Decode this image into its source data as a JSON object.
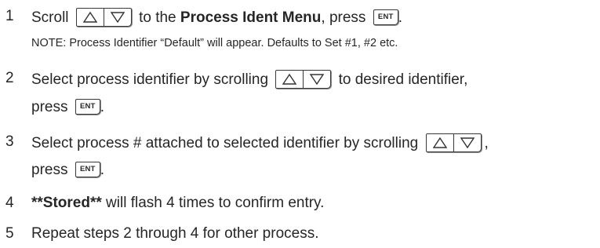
{
  "keys": {
    "enter": "ENT"
  },
  "icons": {
    "up": "up-triangle-icon",
    "down": "down-triangle-icon"
  },
  "steps": [
    {
      "number": "1",
      "pre": "Scroll",
      "mid": "to the",
      "bold": "Process Ident Menu",
      "post": ", press",
      "end": ".",
      "note": "NOTE:  Process Identifier “Default” will appear. Defaults to Set #1, #2 etc."
    },
    {
      "number": "2",
      "line1_pre": "Select process identifier by scrolling",
      "line1_post": "to desired identifier,",
      "line2_pre": "press",
      "line2_end": "."
    },
    {
      "number": "3",
      "line1_pre": "Select process # attached to selected identifier by scrolling",
      "line1_end": ",",
      "line2_pre": "press",
      "line2_end": "."
    },
    {
      "number": "4",
      "bold": "**Stored**",
      "text": " will flash 4 times to confirm entry."
    },
    {
      "number": "5",
      "text": "Repeat steps 2 through 4 for other process."
    }
  ]
}
